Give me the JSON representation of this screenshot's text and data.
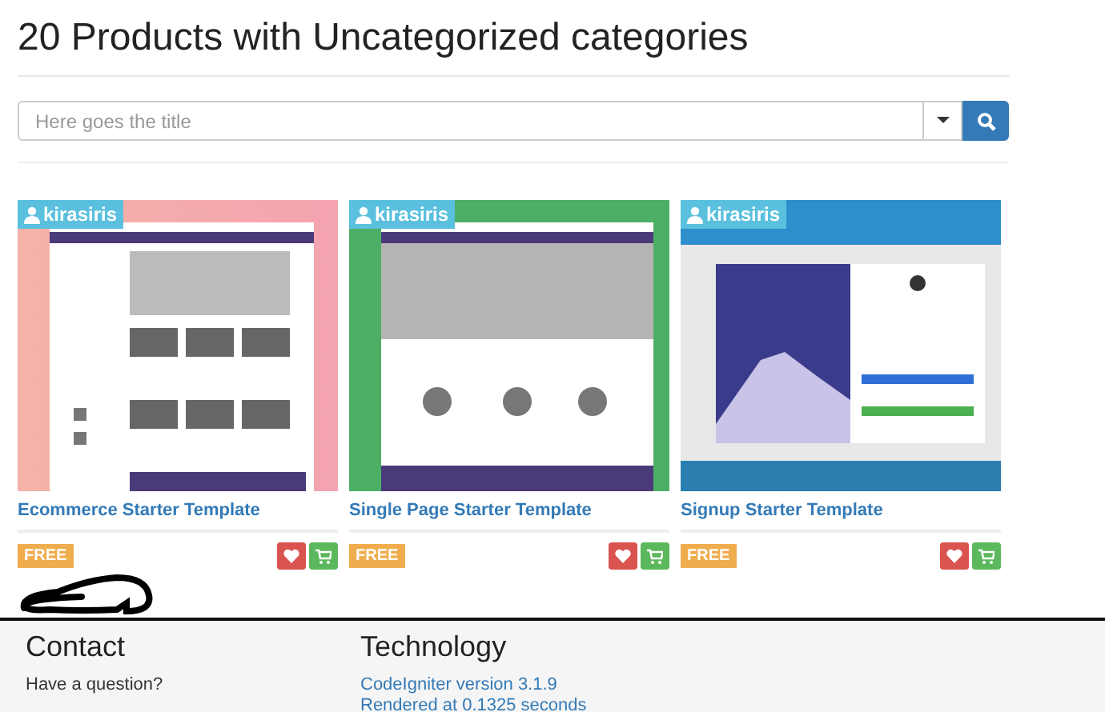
{
  "heading": "20 Products with Uncategorized categories",
  "search": {
    "placeholder": "Here goes the title"
  },
  "products": [
    {
      "author": "kirasiris",
      "title": "Ecommerce Starter Template",
      "price": "FREE"
    },
    {
      "author": "kirasiris",
      "title": "Single Page Starter Template",
      "price": "FREE"
    },
    {
      "author": "kirasiris",
      "title": "Signup Starter Template",
      "price": "FREE"
    }
  ],
  "footer": {
    "columns": [
      {
        "title": "Contact",
        "items": [
          {
            "kind": "text",
            "label": "Have a question?"
          }
        ]
      },
      {
        "title": "Technology",
        "items": [
          {
            "kind": "link",
            "label": "CodeIgniter version 3.1.9"
          },
          {
            "kind": "link",
            "label": "Rendered at 0.1325 seconds"
          }
        ]
      }
    ]
  }
}
